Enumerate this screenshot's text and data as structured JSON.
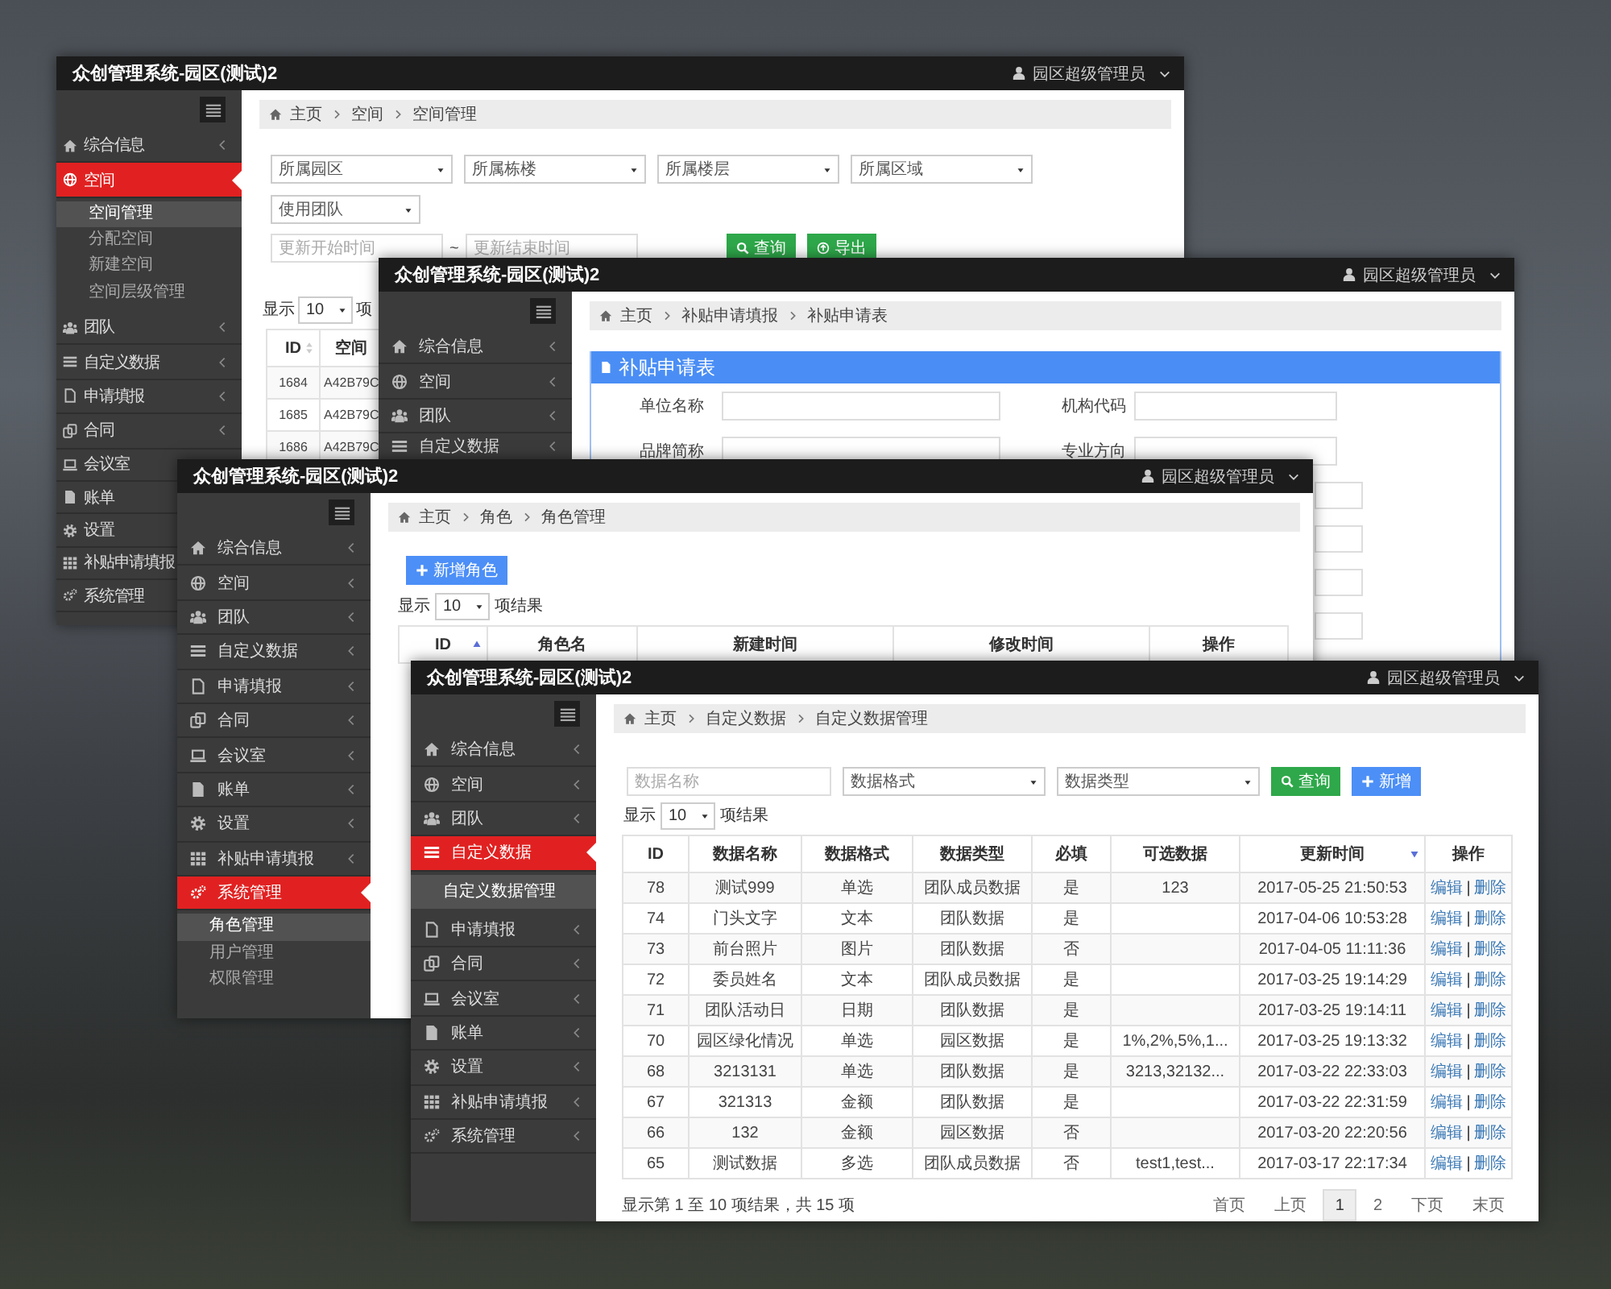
{
  "windows": [
    {
      "title": "众创管理系统-园区(测试)2",
      "user": "园区超级管理员",
      "breadcrumb": [
        "主页",
        "空间",
        "空间管理"
      ],
      "sidebar": [
        {
          "label": "综合信息",
          "selected": false
        },
        {
          "label": "空间",
          "selected": true,
          "children": [
            {
              "label": "空间管理",
              "selected": true
            },
            {
              "label": "分配空间",
              "selected": false
            },
            {
              "label": "新建空间",
              "selected": false
            },
            {
              "label": "空间层级管理",
              "selected": false
            }
          ]
        },
        {
          "label": "团队",
          "selected": false
        },
        {
          "label": "自定义数据",
          "selected": false
        },
        {
          "label": "申请填报",
          "selected": false
        },
        {
          "label": "合同",
          "selected": false
        },
        {
          "label": "会议室",
          "selected": false
        },
        {
          "label": "账单",
          "selected": false
        },
        {
          "label": "设置",
          "selected": false
        },
        {
          "label": "补贴申请填报",
          "selected": false
        },
        {
          "label": "系统管理",
          "selected": false
        }
      ],
      "blocks": [
        {
          "kind": "filters",
          "fields": [
            {
              "kind": "select",
              "placeholder": "所属园区"
            },
            {
              "kind": "select",
              "placeholder": "所属栋楼"
            },
            {
              "kind": "select",
              "placeholder": "所属楼层"
            },
            {
              "kind": "select",
              "placeholder": "所属区域"
            },
            {
              "kind": "select",
              "placeholder": "使用团队"
            }
          ]
        },
        {
          "kind": "date_filters",
          "fields": [
            {
              "kind": "input",
              "placeholder": "更新开始时间"
            },
            {
              "kind": "separator",
              "text": "~"
            },
            {
              "kind": "input",
              "placeholder": "更新结束时间"
            },
            {
              "kind": "query_button",
              "label": "查询"
            },
            {
              "kind": "export_button",
              "label": "导出"
            }
          ]
        },
        {
          "kind": "length",
          "before": "显示",
          "value": "10",
          "after": "项"
        },
        {
          "kind": "table",
          "columns": [
            {
              "label": "ID",
              "kind": "sortable"
            },
            {
              "label": "空间"
            }
          ],
          "rows": [
            {
              "cells": [
                "1684",
                "A42B79C"
              ]
            },
            {
              "cells": [
                "1685",
                "A42B79C"
              ]
            },
            {
              "cells": [
                "1686",
                "A42B79C"
              ]
            }
          ]
        }
      ]
    },
    {
      "title": "众创管理系统-园区(测试)2",
      "user": "园区超级管理员",
      "breadcrumb": [
        "主页",
        "补贴申请填报",
        "补贴申请表"
      ],
      "sidebar": [
        {
          "label": "综合信息",
          "selected": false
        },
        {
          "label": "空间",
          "selected": false
        },
        {
          "label": "团队",
          "selected": false
        },
        {
          "label": "自定义数据",
          "selected": false
        }
      ],
      "blocks": [
        {
          "kind": "form",
          "title": "补贴申请表",
          "fields": [
            {
              "label": "单位名称"
            },
            {
              "label": "机构代码"
            },
            {
              "label": "品牌简称"
            },
            {
              "label": "专业方向"
            }
          ],
          "more_fields": [
            {
              "kind": "input"
            },
            {
              "kind": "input"
            },
            {
              "kind": "input"
            },
            {
              "kind": "input"
            }
          ]
        }
      ]
    },
    {
      "title": "众创管理系统-园区(测试)2",
      "user": "园区超级管理员",
      "breadcrumb": [
        "主页",
        "角色",
        "角色管理"
      ],
      "sidebar": [
        {
          "label": "综合信息",
          "selected": false
        },
        {
          "label": "空间",
          "selected": false
        },
        {
          "label": "团队",
          "selected": false
        },
        {
          "label": "自定义数据",
          "selected": false
        },
        {
          "label": "申请填报",
          "selected": false
        },
        {
          "label": "合同",
          "selected": false
        },
        {
          "label": "会议室",
          "selected": false
        },
        {
          "label": "账单",
          "selected": false
        },
        {
          "label": "设置",
          "selected": false
        },
        {
          "label": "补贴申请填报",
          "selected": false
        },
        {
          "label": "系统管理",
          "selected": true,
          "children": [
            {
              "label": "角色管理",
              "selected": true
            },
            {
              "label": "用户管理",
              "selected": false
            },
            {
              "label": "权限管理",
              "selected": false
            }
          ]
        }
      ],
      "blocks": [
        {
          "kind": "buttons",
          "buttons": [
            {
              "kind": "add_button",
              "label": "新增角色"
            }
          ]
        },
        {
          "kind": "length",
          "before": "显示",
          "value": "10",
          "after": "项结果"
        },
        {
          "kind": "table",
          "columns": [
            {
              "label": "ID",
              "kind": "sorted_asc"
            },
            {
              "label": "角色名"
            },
            {
              "label": "新建时间"
            },
            {
              "label": "修改时间"
            },
            {
              "label": "操作"
            }
          ]
        }
      ]
    },
    {
      "title": "众创管理系统-园区(测试)2",
      "user": "园区超级管理员",
      "breadcrumb": [
        "主页",
        "自定义数据",
        "自定义数据管理"
      ],
      "sidebar": [
        {
          "label": "综合信息",
          "selected": false
        },
        {
          "label": "空间",
          "selected": false
        },
        {
          "label": "团队",
          "selected": false
        },
        {
          "label": "自定义数据",
          "selected": true,
          "children": [
            {
              "label": "自定义数据管理",
              "selected": true
            }
          ]
        },
        {
          "label": "申请填报",
          "selected": false
        },
        {
          "label": "合同",
          "selected": false
        },
        {
          "label": "会议室",
          "selected": false
        },
        {
          "label": "账单",
          "selected": false
        },
        {
          "label": "设置",
          "selected": false
        },
        {
          "label": "补贴申请填报",
          "selected": false
        },
        {
          "label": "系统管理",
          "selected": false
        }
      ],
      "blocks": [
        {
          "kind": "filters",
          "fields": [
            {
              "kind": "input",
              "placeholder": "数据名称"
            },
            {
              "kind": "select",
              "placeholder": "数据格式"
            },
            {
              "kind": "select",
              "placeholder": "数据类型"
            },
            {
              "kind": "query_button",
              "label": "查询"
            },
            {
              "kind": "add_button",
              "label": "新增"
            }
          ]
        },
        {
          "kind": "length",
          "before": "显示",
          "value": "10",
          "after": "项结果"
        },
        {
          "kind": "table",
          "action_separator": "|",
          "columns": [
            {
              "label": "ID"
            },
            {
              "label": "数据名称"
            },
            {
              "label": "数据格式"
            },
            {
              "label": "数据类型"
            },
            {
              "label": "必填"
            },
            {
              "label": "可选数据"
            },
            {
              "label": "更新时间",
              "kind": "sorted_desc"
            },
            {
              "label": "操作"
            }
          ],
          "rows": [
            {
              "cells": [
                "78",
                "测试999",
                "单选",
                "团队成员数据",
                "是",
                "123",
                "2017-05-25 21:50:53"
              ],
              "actions": [
                "编辑",
                "删除"
              ]
            },
            {
              "cells": [
                "74",
                "门头文字",
                "文本",
                "团队数据",
                "是",
                null,
                "2017-04-06 10:53:28"
              ],
              "actions": [
                "编辑",
                "删除"
              ]
            },
            {
              "cells": [
                "73",
                "前台照片",
                "图片",
                "团队数据",
                "否",
                null,
                "2017-04-05 11:11:36"
              ],
              "actions": [
                "编辑",
                "删除"
              ]
            },
            {
              "cells": [
                "72",
                "委员姓名",
                "文本",
                "团队成员数据",
                "是",
                null,
                "2017-03-25 19:14:29"
              ],
              "actions": [
                "编辑",
                "删除"
              ]
            },
            {
              "cells": [
                "71",
                "团队活动日",
                "日期",
                "团队数据",
                "是",
                null,
                "2017-03-25 19:14:11"
              ],
              "actions": [
                "编辑",
                "删除"
              ]
            },
            {
              "cells": [
                "70",
                "园区绿化情况",
                "单选",
                "园区数据",
                "是",
                "1%,2%,5%,1...",
                "2017-03-25 19:13:32"
              ],
              "actions": [
                "编辑",
                "删除"
              ]
            },
            {
              "cells": [
                "68",
                "3213131",
                "单选",
                "团队数据",
                "是",
                "3213,32132...",
                "2017-03-22 22:33:03"
              ],
              "actions": [
                "编辑",
                "删除"
              ]
            },
            {
              "cells": [
                "67",
                "321313",
                "金额",
                "团队数据",
                "是",
                null,
                "2017-03-22 22:31:59"
              ],
              "actions": [
                "编辑",
                "删除"
              ]
            },
            {
              "cells": [
                "66",
                "132",
                "金额",
                "园区数据",
                "否",
                null,
                "2017-03-20 22:20:56"
              ],
              "actions": [
                "编辑",
                "删除"
              ]
            },
            {
              "cells": [
                "65",
                "测试数据",
                "多选",
                "团队成员数据",
                "否",
                "test1,test...",
                "2017-03-17 22:17:34"
              ],
              "actions": [
                "编辑",
                "删除"
              ]
            }
          ]
        },
        {
          "kind": "footer",
          "info": "显示第 1 至 10 项结果，共 15 项",
          "pages": [
            {
              "label": "首页",
              "selected": false
            },
            {
              "label": "上页",
              "selected": false
            },
            {
              "label": "1",
              "selected": true
            },
            {
              "label": "2",
              "selected": false
            },
            {
              "label": "下页",
              "selected": false
            },
            {
              "label": "末页",
              "selected": false
            }
          ]
        }
      ]
    }
  ]
}
